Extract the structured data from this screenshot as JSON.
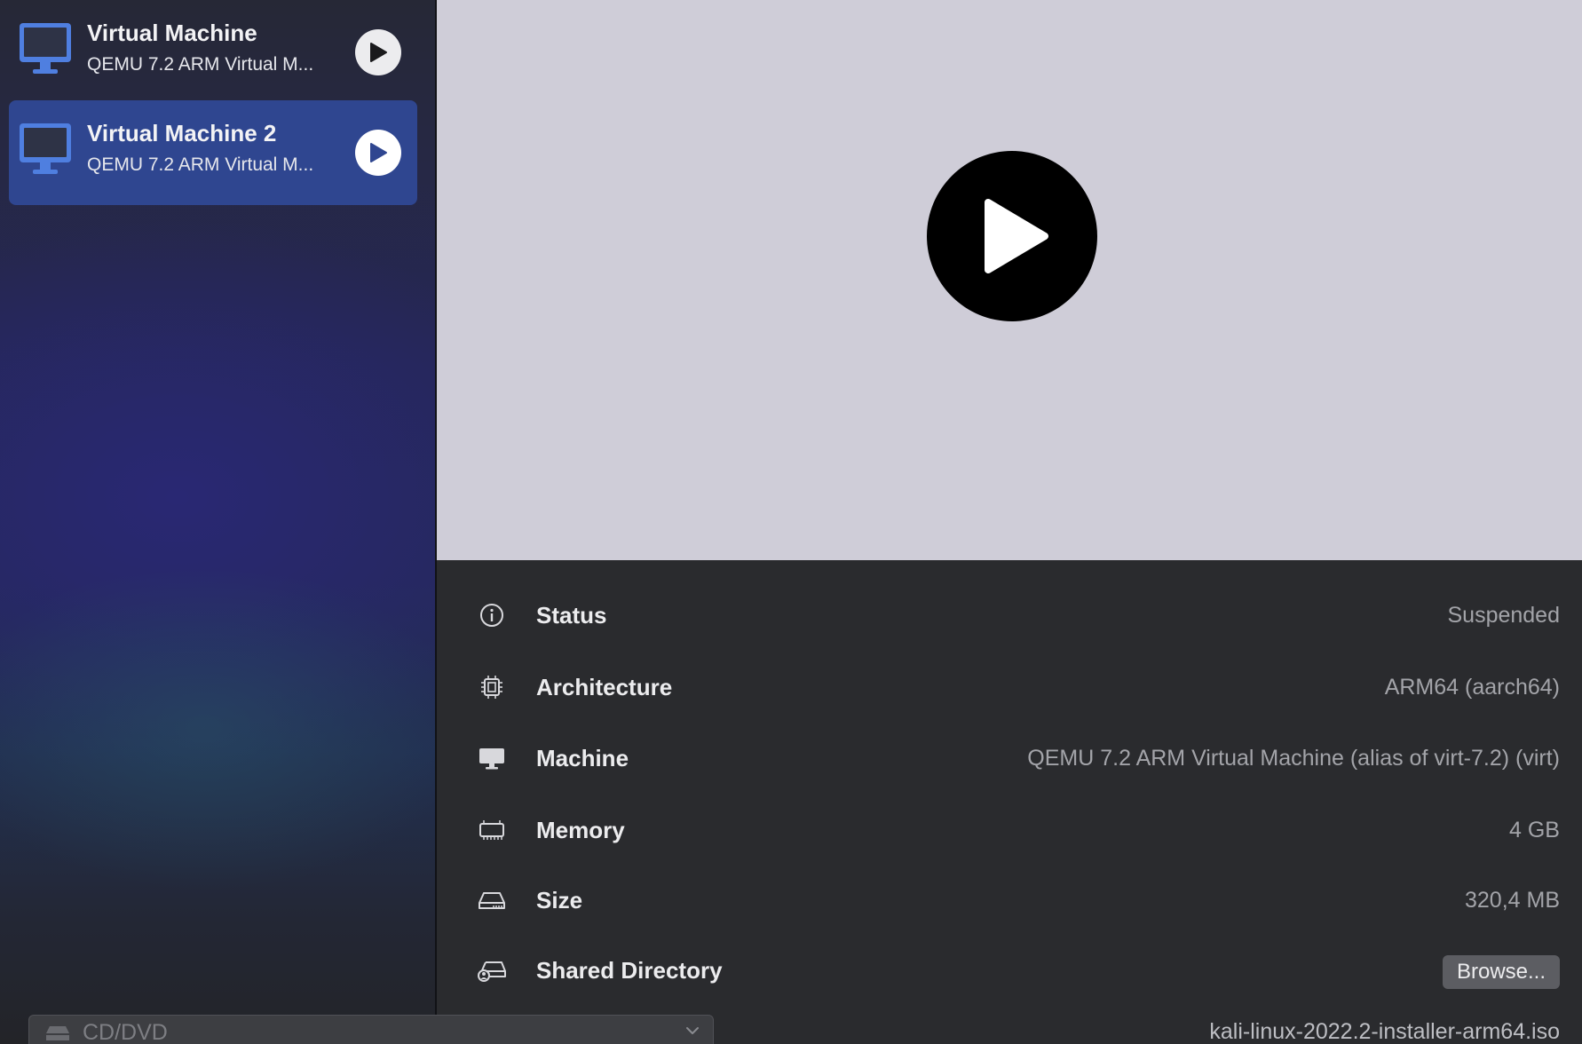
{
  "sidebar": {
    "items": [
      {
        "name": "Virtual Machine",
        "subtitle": "QEMU 7.2 ARM Virtual M...",
        "selected": false
      },
      {
        "name": "Virtual Machine 2",
        "subtitle": "QEMU 7.2 ARM Virtual M...",
        "selected": true
      }
    ]
  },
  "details": {
    "status": {
      "label": "Status",
      "value": "Suspended",
      "icon": "info-icon"
    },
    "architecture": {
      "label": "Architecture",
      "value": "ARM64 (aarch64)",
      "icon": "cpu-icon"
    },
    "machine": {
      "label": "Machine",
      "value": "QEMU 7.2 ARM Virtual Machine (alias of virt-7.2) (virt)",
      "icon": "monitor-icon"
    },
    "memory": {
      "label": "Memory",
      "value": "4 GB",
      "icon": "memory-icon"
    },
    "size": {
      "label": "Size",
      "value": "320,4 MB",
      "icon": "drive-icon"
    },
    "shared_directory": {
      "label": "Shared Directory",
      "button": "Browse...",
      "icon": "shared-drive-icon"
    },
    "cd_dvd": {
      "label": "CD/DVD",
      "file": "kali-linux-2022.2-installer-arm64.iso",
      "icon": "disc-drive-icon"
    }
  },
  "colors": {
    "accent_selected": "#2f4690",
    "preview_bg": "#cfcdd8",
    "details_bg": "#2a2b2e",
    "monitor_blue": "#4f7fe0"
  }
}
